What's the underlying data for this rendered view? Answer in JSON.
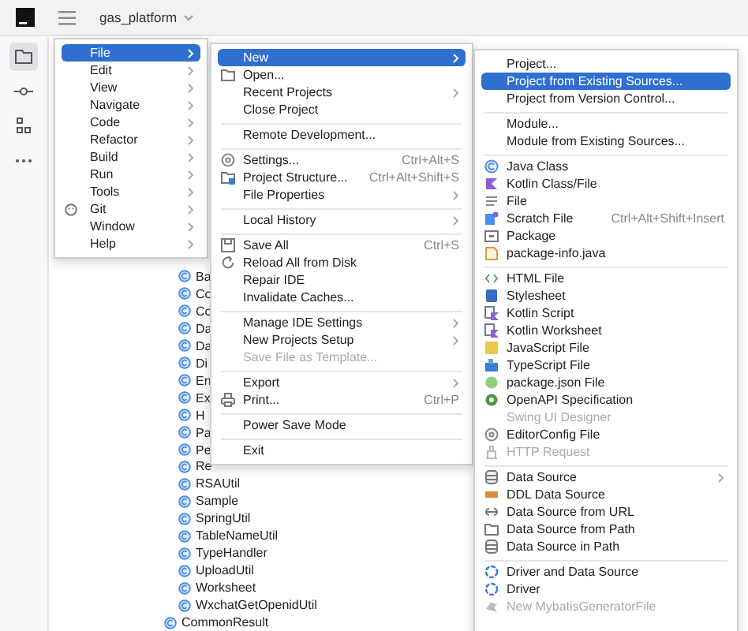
{
  "title_bar": {
    "project": "gas_platform"
  },
  "tool_window_bar": {
    "items": [
      {
        "selected": true
      },
      {
        "selected": false
      },
      {
        "selected": false
      },
      {
        "selected": false
      }
    ]
  },
  "project_tree": {
    "items": [
      {
        "children": [
          {
            "label": "Ba"
          },
          {
            "label": "Co"
          },
          {
            "label": "Co"
          },
          {
            "label": "Da"
          },
          {
            "label": "Da"
          },
          {
            "label": "Di"
          },
          {
            "label": "En"
          },
          {
            "label": "Ex"
          },
          {
            "label": "H"
          },
          {
            "label": "Pa"
          },
          {
            "label": "Pe"
          },
          {
            "label": "Re"
          },
          {
            "label": "RSAUtil"
          },
          {
            "label": "Sample"
          },
          {
            "label": "SpringUtil"
          },
          {
            "label": "TableNameUtil"
          },
          {
            "label": "TypeHandler"
          },
          {
            "label": "UploadUtil"
          },
          {
            "label": "Worksheet"
          },
          {
            "label": "WxchatGetOpenidUtil"
          }
        ]
      },
      {
        "label": "CommonResult"
      }
    ]
  },
  "main_menu": {
    "items": [
      {
        "label": "File",
        "selected": true,
        "has_submenu": true
      },
      {
        "label": "Edit",
        "selected": false,
        "has_submenu": true
      },
      {
        "label": "View",
        "selected": false,
        "has_submenu": true
      },
      {
        "label": "Navigate",
        "selected": false,
        "has_submenu": true
      },
      {
        "label": "Code",
        "selected": false,
        "has_submenu": true
      },
      {
        "label": "Refactor",
        "selected": false,
        "has_submenu": true
      },
      {
        "label": "Build",
        "selected": false,
        "has_submenu": true
      },
      {
        "label": "Run",
        "selected": false,
        "has_submenu": true
      },
      {
        "label": "Tools",
        "selected": false,
        "has_submenu": true
      },
      {
        "label": "Git",
        "selected": false,
        "has_submenu": true
      },
      {
        "label": "Window",
        "selected": false,
        "has_submenu": true
      },
      {
        "label": "Help",
        "selected": false,
        "has_submenu": true
      }
    ]
  },
  "file_menu": {
    "groups": [
      [
        {
          "label": "New",
          "selected": true,
          "disabled": false,
          "has_submenu": true
        },
        {
          "label": "Open...",
          "selected": false,
          "disabled": false,
          "has_submenu": false
        },
        {
          "label": "Recent Projects",
          "selected": false,
          "disabled": false,
          "has_submenu": true
        },
        {
          "label": "Close Project",
          "selected": false,
          "disabled": false,
          "has_submenu": false
        }
      ],
      [
        {
          "label": "Remote Development...",
          "selected": false,
          "disabled": false,
          "has_submenu": false
        }
      ],
      [
        {
          "label": "Settings...",
          "shortcut": "Ctrl+Alt+S",
          "selected": false,
          "disabled": false,
          "has_submenu": false
        },
        {
          "label": "Project Structure...",
          "shortcut": "Ctrl+Alt+Shift+S",
          "selected": false,
          "disabled": false,
          "has_submenu": false
        },
        {
          "label": "File Properties",
          "selected": false,
          "disabled": false,
          "has_submenu": true
        }
      ],
      [
        {
          "label": "Local History",
          "selected": false,
          "disabled": false,
          "has_submenu": true
        }
      ],
      [
        {
          "label": "Save All",
          "shortcut": "Ctrl+S",
          "selected": false,
          "disabled": false,
          "has_submenu": false
        },
        {
          "label": "Reload All from Disk",
          "selected": false,
          "disabled": false,
          "has_submenu": false
        },
        {
          "label": "Repair IDE",
          "selected": false,
          "disabled": false,
          "has_submenu": false
        },
        {
          "label": "Invalidate Caches...",
          "selected": false,
          "disabled": false,
          "has_submenu": false
        }
      ],
      [
        {
          "label": "Manage IDE Settings",
          "selected": false,
          "disabled": false,
          "has_submenu": true
        },
        {
          "label": "New Projects Setup",
          "selected": false,
          "disabled": false,
          "has_submenu": true
        },
        {
          "label": "Save File as Template...",
          "selected": false,
          "disabled": true,
          "has_submenu": false
        }
      ],
      [
        {
          "label": "Export",
          "selected": false,
          "disabled": false,
          "has_submenu": true
        },
        {
          "label": "Print...",
          "shortcut": "Ctrl+P",
          "selected": false,
          "disabled": false,
          "has_submenu": false
        }
      ],
      [
        {
          "label": "Power Save Mode",
          "selected": false,
          "disabled": false,
          "has_submenu": false
        }
      ],
      [
        {
          "label": "Exit",
          "selected": false,
          "disabled": false,
          "has_submenu": false
        }
      ]
    ]
  },
  "new_menu": {
    "groups": [
      [
        {
          "label": "Project...",
          "selected": false,
          "disabled": false,
          "has_submenu": false
        },
        {
          "label": "Project from Existing Sources...",
          "selected": true,
          "disabled": false,
          "has_submenu": false
        },
        {
          "label": "Project from Version Control...",
          "selected": false,
          "disabled": false,
          "has_submenu": false
        }
      ],
      [
        {
          "label": "Module...",
          "selected": false,
          "disabled": false,
          "has_submenu": false
        },
        {
          "label": "Module from Existing Sources...",
          "selected": false,
          "disabled": false,
          "has_submenu": false
        }
      ],
      [
        {
          "label": "Java Class",
          "selected": false,
          "disabled": false,
          "has_submenu": false
        },
        {
          "label": "Kotlin Class/File",
          "selected": false,
          "disabled": false,
          "has_submenu": false
        },
        {
          "label": "File",
          "selected": false,
          "disabled": false,
          "has_submenu": false
        },
        {
          "label": "Scratch File",
          "shortcut": "Ctrl+Alt+Shift+Insert",
          "selected": false,
          "disabled": false,
          "has_submenu": false
        },
        {
          "label": "Package",
          "selected": false,
          "disabled": false,
          "has_submenu": false
        },
        {
          "label": "package-info.java",
          "selected": false,
          "disabled": false,
          "has_submenu": false
        }
      ],
      [
        {
          "label": "HTML File",
          "selected": false,
          "disabled": false,
          "has_submenu": false
        },
        {
          "label": "Stylesheet",
          "selected": false,
          "disabled": false,
          "has_submenu": false
        },
        {
          "label": "Kotlin Script",
          "selected": false,
          "disabled": false,
          "has_submenu": false
        },
        {
          "label": "Kotlin Worksheet",
          "selected": false,
          "disabled": false,
          "has_submenu": false
        },
        {
          "label": "JavaScript File",
          "selected": false,
          "disabled": false,
          "has_submenu": false
        },
        {
          "label": "TypeScript File",
          "selected": false,
          "disabled": false,
          "has_submenu": false
        },
        {
          "label": "package.json File",
          "selected": false,
          "disabled": false,
          "has_submenu": false
        },
        {
          "label": "OpenAPI Specification",
          "selected": false,
          "disabled": false,
          "has_submenu": false
        },
        {
          "label": "Swing UI Designer",
          "selected": false,
          "disabled": true,
          "has_submenu": false
        },
        {
          "label": "EditorConfig File",
          "selected": false,
          "disabled": false,
          "has_submenu": false
        },
        {
          "label": "HTTP Request",
          "selected": false,
          "disabled": true,
          "has_submenu": false
        }
      ],
      [
        {
          "label": "Data Source",
          "selected": false,
          "disabled": false,
          "has_submenu": true
        },
        {
          "label": "DDL Data Source",
          "selected": false,
          "disabled": false,
          "has_submenu": false
        },
        {
          "label": "Data Source from URL",
          "selected": false,
          "disabled": false,
          "has_submenu": false
        },
        {
          "label": "Data Source from Path",
          "selected": false,
          "disabled": false,
          "has_submenu": false
        },
        {
          "label": "Data Source in Path",
          "selected": false,
          "disabled": false,
          "has_submenu": false
        }
      ],
      [
        {
          "label": "Driver and Data Source",
          "selected": false,
          "disabled": false,
          "has_submenu": false
        },
        {
          "label": "Driver",
          "selected": false,
          "disabled": false,
          "has_submenu": false
        },
        {
          "label": "New MybatisGeneratorFile",
          "selected": false,
          "disabled": true,
          "has_submenu": false
        }
      ]
    ]
  }
}
